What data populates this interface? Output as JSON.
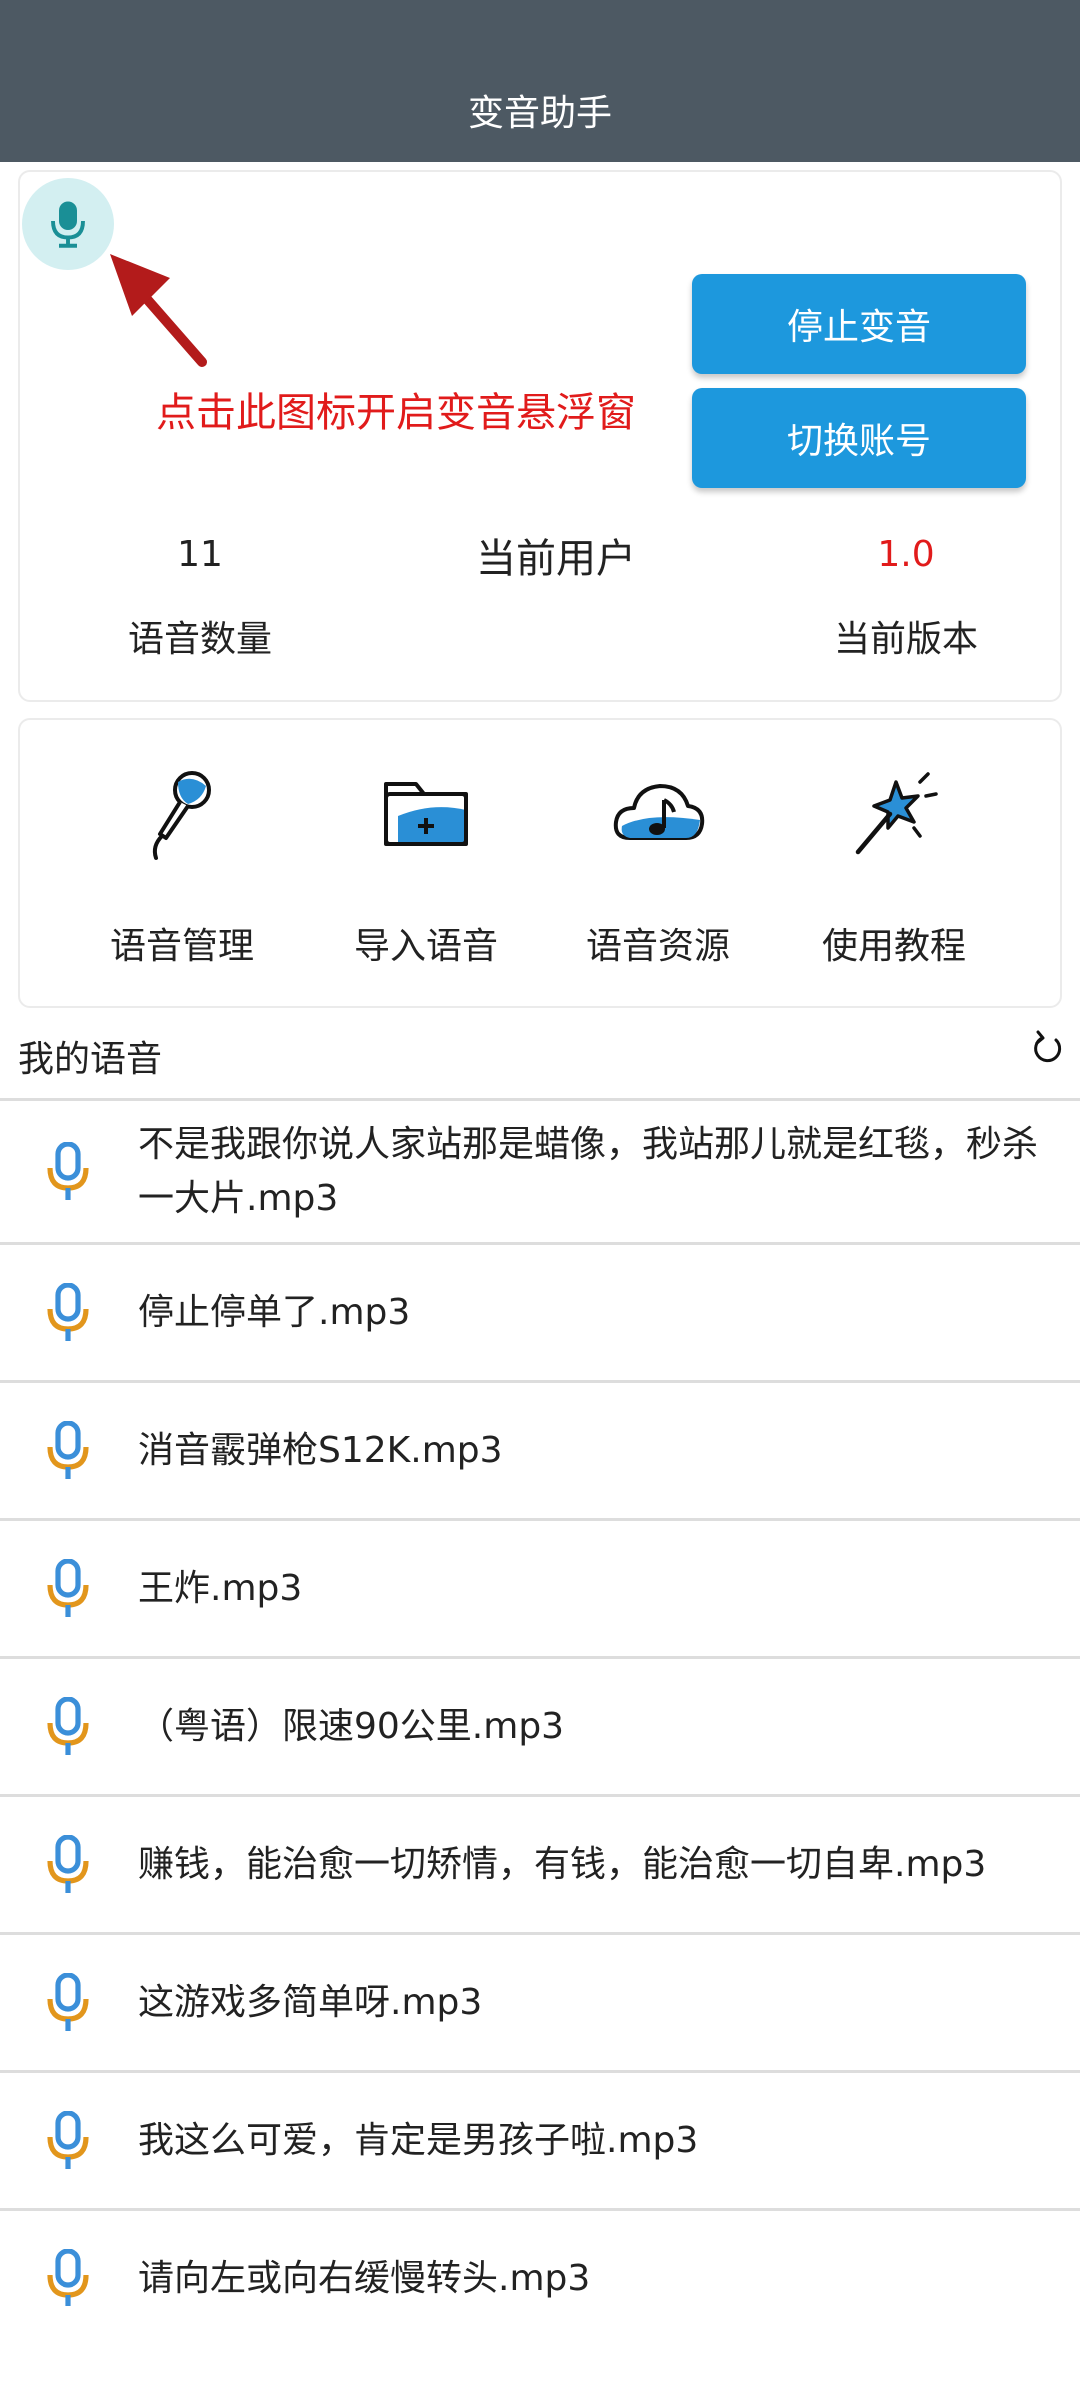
{
  "header": {
    "title": "变音助手"
  },
  "hint": {
    "text": "点击此图标开启变音悬浮窗"
  },
  "buttons": {
    "stop_label": "停止变音",
    "switch_label": "切换账号"
  },
  "stats": {
    "voice_count": "11",
    "voice_count_label": "语音数量",
    "current_user_label": "当前用户",
    "version": "1.0",
    "version_label": "当前版本"
  },
  "actions": [
    {
      "label": "语音管理",
      "icon": "microphone-icon"
    },
    {
      "label": "导入语音",
      "icon": "folder-add-icon"
    },
    {
      "label": "语音资源",
      "icon": "cloud-music-icon"
    },
    {
      "label": "使用教程",
      "icon": "magic-wand-icon"
    }
  ],
  "my_voices": {
    "title": "我的语音",
    "items": [
      "不是我跟你说人家站那是蜡像，我站那儿就是红毯，秒杀一大片.mp3",
      "停止停单了.mp3",
      "消音霰弹枪S12K.mp3",
      "王炸.mp3",
      "（粤语）限速90公里.mp3",
      "赚钱，能治愈一切矫情，有钱，能治愈一切自卑.mp3",
      "这游戏多简单呀.mp3",
      "我这么可爱，肯定是男孩子啦.mp3",
      "请向左或向右缓慢转头.mp3"
    ]
  },
  "colors": {
    "appbar": "#4d5963",
    "button": "#1d98dd",
    "accent_red": "#e11b1b",
    "teal": "#1a8f96",
    "mic_blue": "#3b8fd9",
    "mic_orange": "#e2961c"
  }
}
